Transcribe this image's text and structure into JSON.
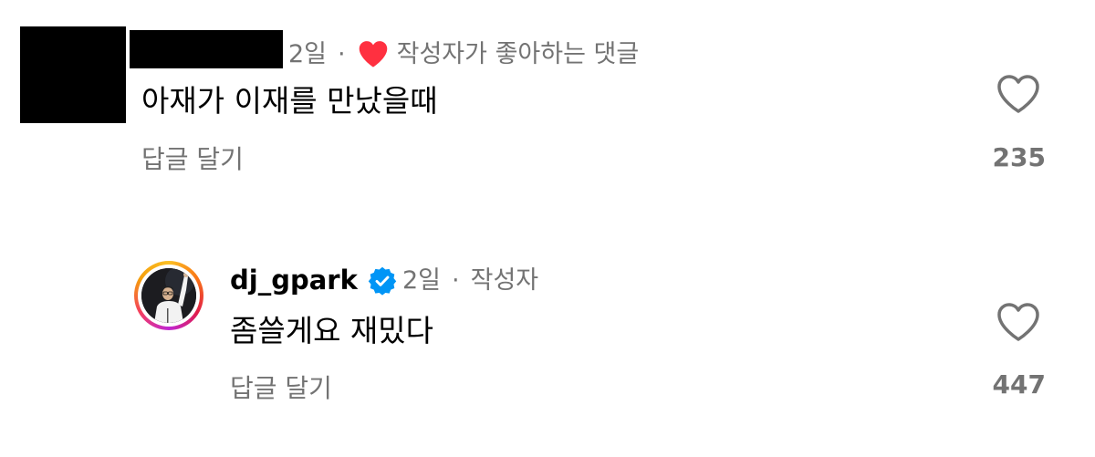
{
  "comments": [
    {
      "time": "2일",
      "separator": "·",
      "liked_by_author_label": "작성자가 좋아하는 댓글",
      "text": "아재가 이재를 만났을때",
      "reply_label": "답글 달기",
      "like_count": "235"
    },
    {
      "username": "dj_gpark",
      "verified": true,
      "time": "2일",
      "separator": "·",
      "author_badge": "작성자",
      "text": "좀쓸게요 재밌다",
      "reply_label": "답글 달기",
      "like_count": "447"
    }
  ],
  "icons": {
    "liked_by_author": "heart-filled-icon",
    "like": "heart-outline-icon",
    "verified": "verified-badge-icon"
  },
  "colors": {
    "secondary_text": "#737373",
    "heart_red": "#ff3040",
    "verified_blue": "#0095f6"
  }
}
